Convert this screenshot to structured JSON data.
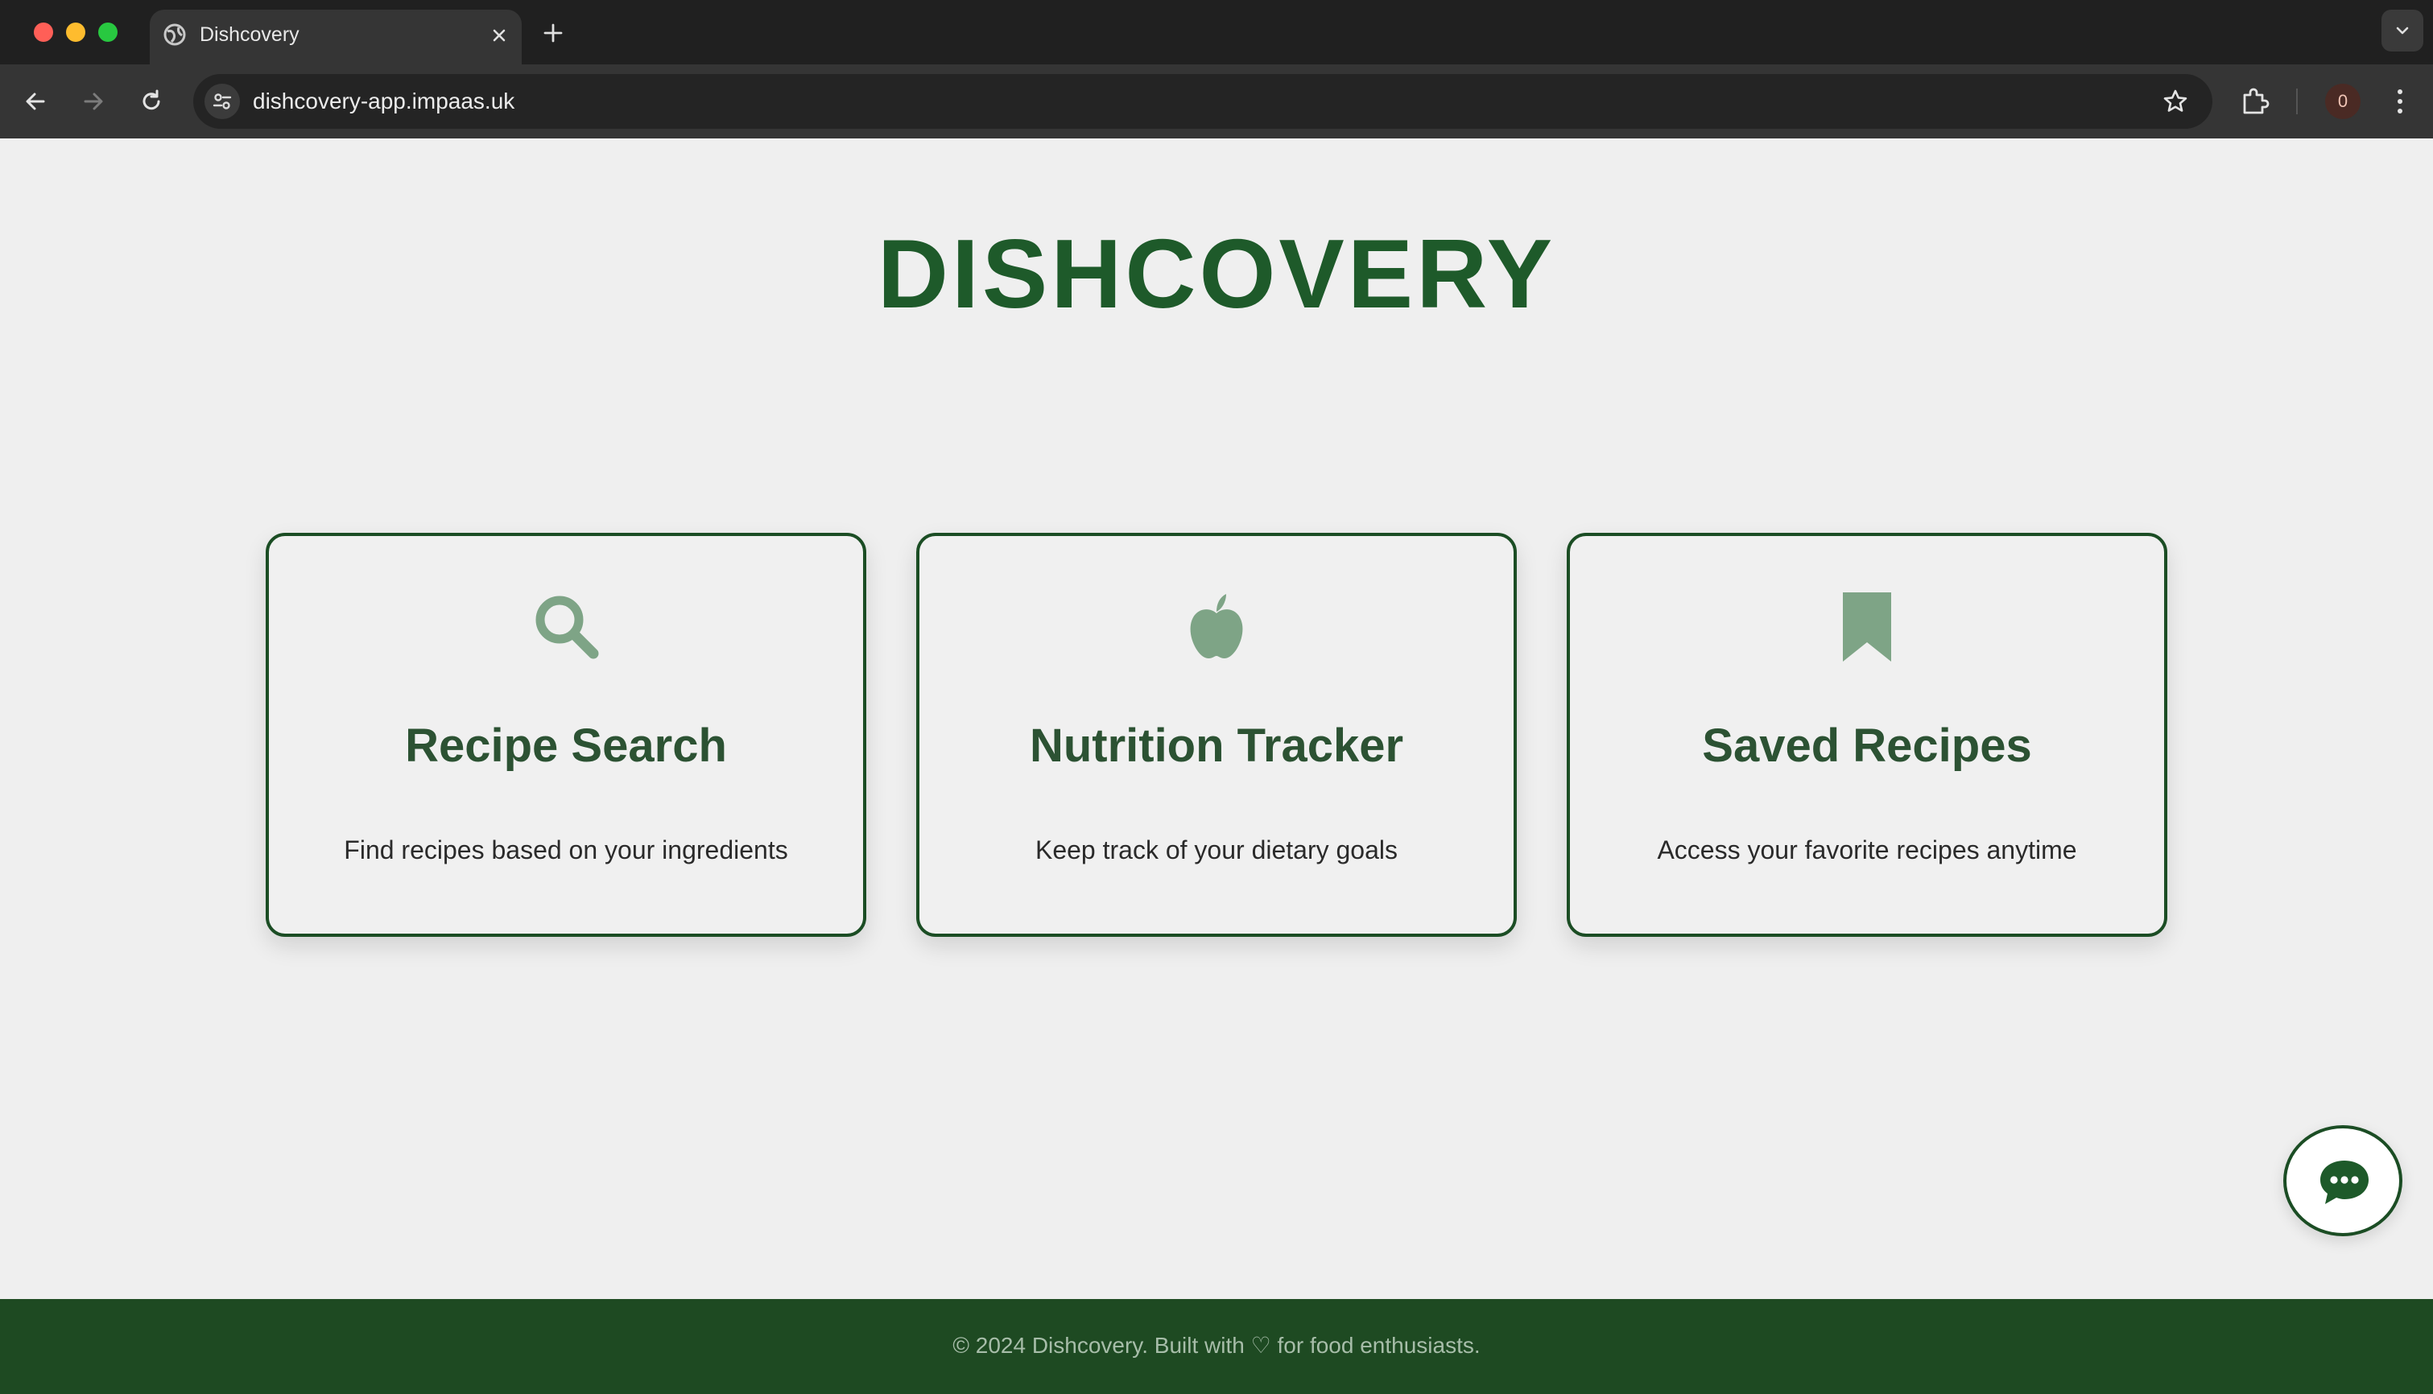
{
  "browser": {
    "tab_title": "Dishcovery",
    "url": "dishcovery-app.impaas.uk",
    "profile_badge": "0",
    "icons": [
      "globe-icon",
      "close-icon",
      "plus-icon",
      "chevron-down-icon",
      "back-arrow-icon",
      "forward-arrow-icon",
      "reload-icon",
      "site-settings-icon",
      "star-icon",
      "puzzle-icon",
      "kebab-menu-icon"
    ]
  },
  "page": {
    "title": "DISHCOVERY",
    "brand_color": "#1e5a2a",
    "icon_color": "#7ea486",
    "cards": [
      {
        "icon": "search-icon",
        "title": "Recipe Search",
        "description": "Find recipes based on your ingredients"
      },
      {
        "icon": "apple-icon",
        "title": "Nutrition Tracker",
        "description": "Keep track of your dietary goals"
      },
      {
        "icon": "bookmark-icon",
        "title": "Saved Recipes",
        "description": "Access your favorite recipes anytime"
      }
    ],
    "chat_button_icon": "chat-bubble-icon"
  },
  "footer": {
    "text": "© 2024 Dishcovery. Built with ♡ for food enthusiasts.",
    "background": "#1e4a22"
  }
}
